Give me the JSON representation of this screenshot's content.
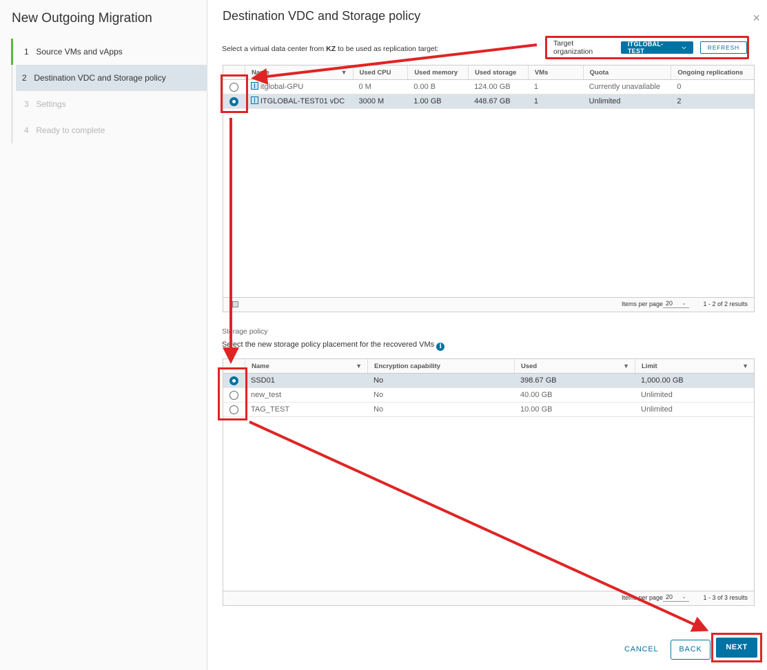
{
  "wizard": {
    "title": "New Outgoing Migration",
    "steps": [
      {
        "num": "1",
        "label": "Source VMs and vApps"
      },
      {
        "num": "2",
        "label": "Destination VDC and Storage policy"
      },
      {
        "num": "3",
        "label": "Settings"
      },
      {
        "num": "4",
        "label": "Ready to complete"
      }
    ]
  },
  "page": {
    "title": "Destination VDC and Storage policy",
    "close": "×",
    "subtitle_prefix": "Select a virtual data center from ",
    "subtitle_site": "KZ",
    "subtitle_suffix": " to be used as replication target:"
  },
  "target_org": {
    "label": "Target organization",
    "value": "ITGLOBAL-TEST",
    "refresh": "REFRESH"
  },
  "vdc_grid": {
    "columns": [
      "Name",
      "Used CPU",
      "Used memory",
      "Used storage",
      "VMs",
      "Quota",
      "Ongoing replications"
    ],
    "rows": [
      {
        "name": "itglobal-GPU",
        "cpu": "0 M",
        "memory": "0.00 B",
        "storage": "124.00 GB",
        "vms": "1",
        "quota": "Currently unavailable",
        "ongoing": "0",
        "selected": false
      },
      {
        "name": "ITGLOBAL-TEST01 vDC",
        "cpu": "3000 M",
        "memory": "1.00 GB",
        "storage": "448.67 GB",
        "vms": "1",
        "quota": "Unlimited",
        "ongoing": "2",
        "selected": true
      }
    ],
    "items_per_page_label": "Items per page",
    "items_per_page": "20",
    "results": "1 - 2 of 2 results"
  },
  "storage": {
    "label": "Storage policy",
    "description": "Select the new storage policy placement for the recovered VMs",
    "columns": [
      "Name",
      "Encryption capability",
      "Used",
      "Limit"
    ],
    "rows": [
      {
        "name": "SSD01",
        "encryption": "No",
        "used": "398.67 GB",
        "limit": "1,000.00 GB",
        "selected": true
      },
      {
        "name": "new_test",
        "encryption": "No",
        "used": "40.00 GB",
        "limit": "Unlimited",
        "selected": false
      },
      {
        "name": "TAG_TEST",
        "encryption": "No",
        "used": "10.00 GB",
        "limit": "Unlimited",
        "selected": false
      }
    ],
    "items_per_page_label": "Items per page",
    "items_per_page": "20",
    "results": "1 - 3 of 3 results"
  },
  "footer": {
    "cancel": "CANCEL",
    "back": "BACK",
    "next": "NEXT"
  },
  "colors": {
    "accent": "#0072a3",
    "highlight": "#e02424",
    "done": "#5ab53c"
  }
}
